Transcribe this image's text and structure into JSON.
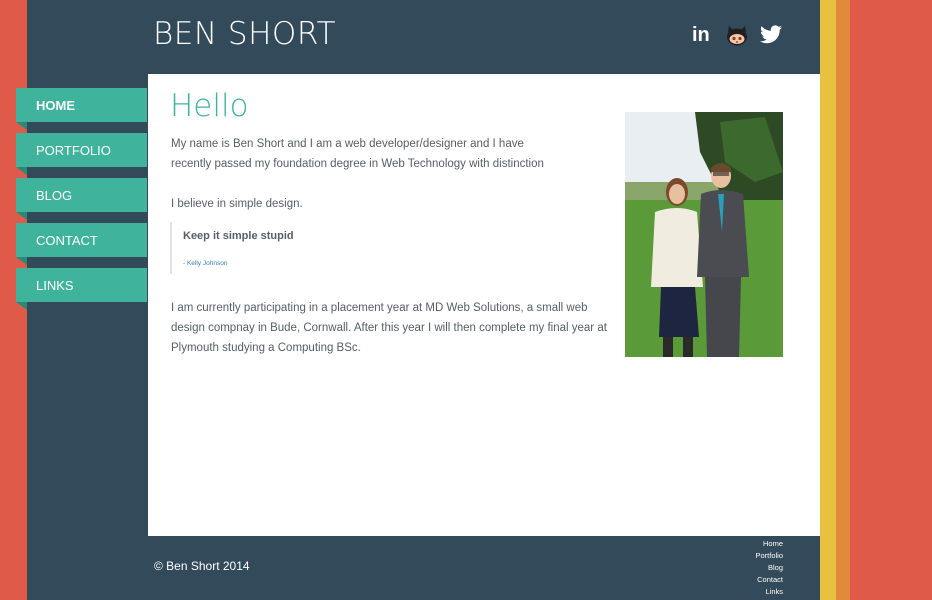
{
  "header": {
    "brand": "BEN SHORT",
    "social": [
      {
        "icon": "linkedin-icon",
        "label": "in"
      },
      {
        "icon": "github-icon"
      },
      {
        "icon": "twitter-icon"
      }
    ]
  },
  "nav": {
    "items": [
      {
        "label": "HOME",
        "active": true
      },
      {
        "label": "PORTFOLIO"
      },
      {
        "label": "BLOG"
      },
      {
        "label": "CONTACT"
      },
      {
        "label": "LINKS"
      }
    ]
  },
  "main": {
    "heading": "Hello",
    "intro": "My name is Ben Short and I am a web developer/designer and I have recently passed my foundation degree in Web Technology with distinction",
    "belief": "I believe in simple design.",
    "quote": {
      "text": "Keep it simple stupid",
      "author": "- Kelly Johnson"
    },
    "placement": "I am currently participating in a placement year at MD Web Solutions, a small web design compnay in Bude, Cornwall.  After this year I will then complete my final year at Plymouth studying a Computing BSc."
  },
  "footer": {
    "copyright": "© Ben Short 2014",
    "links": [
      "Home",
      "Portfolio",
      "Blog",
      "Contact",
      "Links"
    ]
  },
  "colors": {
    "background_red": "#e05a4a",
    "navy": "#324a5a",
    "teal": "#3fb39b",
    "stripe_yellow": "#e8c23e",
    "stripe_orange": "#e28a3c"
  }
}
